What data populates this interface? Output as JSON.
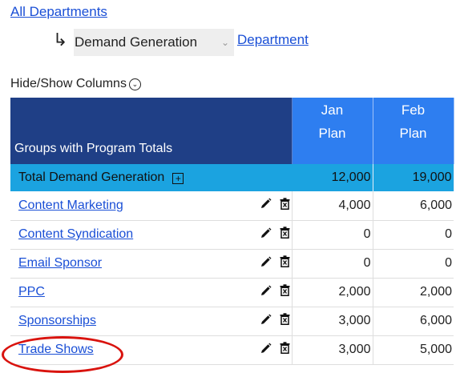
{
  "nav": {
    "all_departments": "All Departments",
    "department_select_value": "Demand Generation",
    "department_link": "Department",
    "hide_show_columns": "Hide/Show Columns"
  },
  "table": {
    "group_header": "Groups with Program Totals",
    "months": [
      {
        "label": "Jan",
        "sub": "Plan"
      },
      {
        "label": "Feb",
        "sub": "Plan"
      }
    ],
    "total_row": {
      "label": "Total Demand Generation",
      "values": [
        "12,000",
        "19,000"
      ]
    },
    "rows": [
      {
        "label": "Content Marketing",
        "values": [
          "4,000",
          "6,000"
        ]
      },
      {
        "label": "Content Syndication",
        "values": [
          "0",
          "0"
        ]
      },
      {
        "label": "Email Sponsor",
        "values": [
          "0",
          "0"
        ]
      },
      {
        "label": "PPC",
        "values": [
          "2,000",
          "2,000"
        ]
      },
      {
        "label": "Sponsorships",
        "values": [
          "3,000",
          "6,000"
        ]
      },
      {
        "label": "Trade Shows",
        "values": [
          "3,000",
          "5,000"
        ]
      }
    ]
  },
  "icons": {
    "arrow": "return-arrow-icon",
    "chevron": "chevron-down-icon",
    "toggle": "chevron-down-circle-icon",
    "expand": "plus-square-icon",
    "edit": "pencil-icon",
    "delete": "trash-icon"
  },
  "colors": {
    "header_dark": "#1f3f86",
    "header_month": "#2e7ef0",
    "total_row": "#1ba3e0",
    "link": "#1a4fd6",
    "annotation_circle": "#d9130e"
  }
}
